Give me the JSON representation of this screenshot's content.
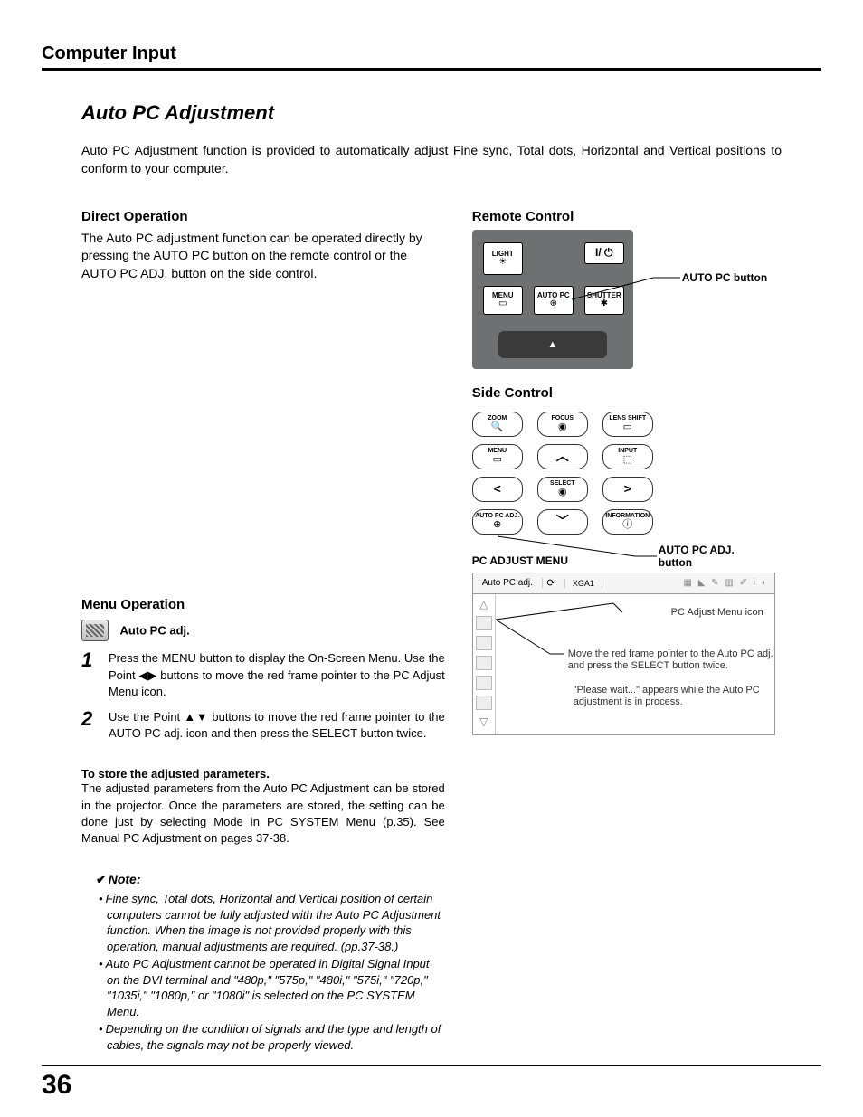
{
  "header": "Computer Input",
  "title": "Auto PC Adjustment",
  "intro": "Auto PC Adjustment function is provided to automatically adjust Fine sync, Total dots, Horizontal and Vertical positions to conform to your computer.",
  "direct": {
    "heading": "Direct Operation",
    "text": "The Auto PC adjustment function can be operated directly by pressing the AUTO PC button on the remote control or the AUTO PC ADJ. button on the side control."
  },
  "menuop": {
    "heading": "Menu Operation",
    "icon_label": "Auto PC adj.",
    "steps": [
      {
        "num": "1",
        "text": "Press the MENU button to display the On-Screen Menu. Use the Point ◀▶ buttons to move the red frame pointer to the PC Adjust Menu icon."
      },
      {
        "num": "2",
        "text": "Use the Point ▲▼ buttons to move the red frame pointer to the AUTO PC adj. icon and then press the SELECT button twice."
      }
    ],
    "store_h": "To store the adjusted parameters.",
    "store_t": "The adjusted parameters from the Auto PC Adjustment can be stored in the projector. Once the parameters are stored, the setting can be done just by selecting Mode in PC SYSTEM Menu (p.35). See Manual PC Adjustment on pages 37-38."
  },
  "note": {
    "heading": "Note:",
    "items": [
      "Fine sync, Total dots, Horizontal and Vertical position of certain computers cannot be fully adjusted with the Auto PC Adjustment function. When the image is not provided properly with this operation, manual adjustments are required. (pp.37-38.)",
      "Auto PC Adjustment cannot be operated in Digital Signal Input on the DVI terminal and \"480p,\" \"575p,\" \"480i,\" \"575i,\" \"720p,\" \"1035i,\" \"1080p,\" or \"1080i\" is selected on the PC SYSTEM Menu.",
      "Depending on the condition of signals and the type and length of cables, the signals may not be properly viewed."
    ]
  },
  "remote": {
    "heading": "Remote Control",
    "callout": "AUTO PC button",
    "buttons": {
      "light": "LIGHT",
      "power": "I/ ⏻",
      "menu": "MENU",
      "autopc": "AUTO PC",
      "shutter": "SHUTTER"
    }
  },
  "side": {
    "heading": "Side Control",
    "callout": "AUTO PC ADJ. button",
    "buttons": {
      "zoom": "ZOOM",
      "focus": "FOCUS",
      "lens": "LENS SHIFT",
      "menu": "MENU",
      "input": "INPUT",
      "select": "SELECT",
      "autopcadj": "AUTO PC ADJ.",
      "info": "INFORMATION"
    }
  },
  "pcmenu": {
    "heading": "PC ADJUST MENU",
    "top_label": "Auto PC adj.",
    "mode": "XGA1",
    "icon_label": "PC Adjust Menu icon",
    "note1": "Move the red frame pointer to the Auto PC adj. and press the SELECT button twice.",
    "note2": "\"Please wait...\" appears while the Auto PC adjustment is in process."
  },
  "page_number": "36"
}
